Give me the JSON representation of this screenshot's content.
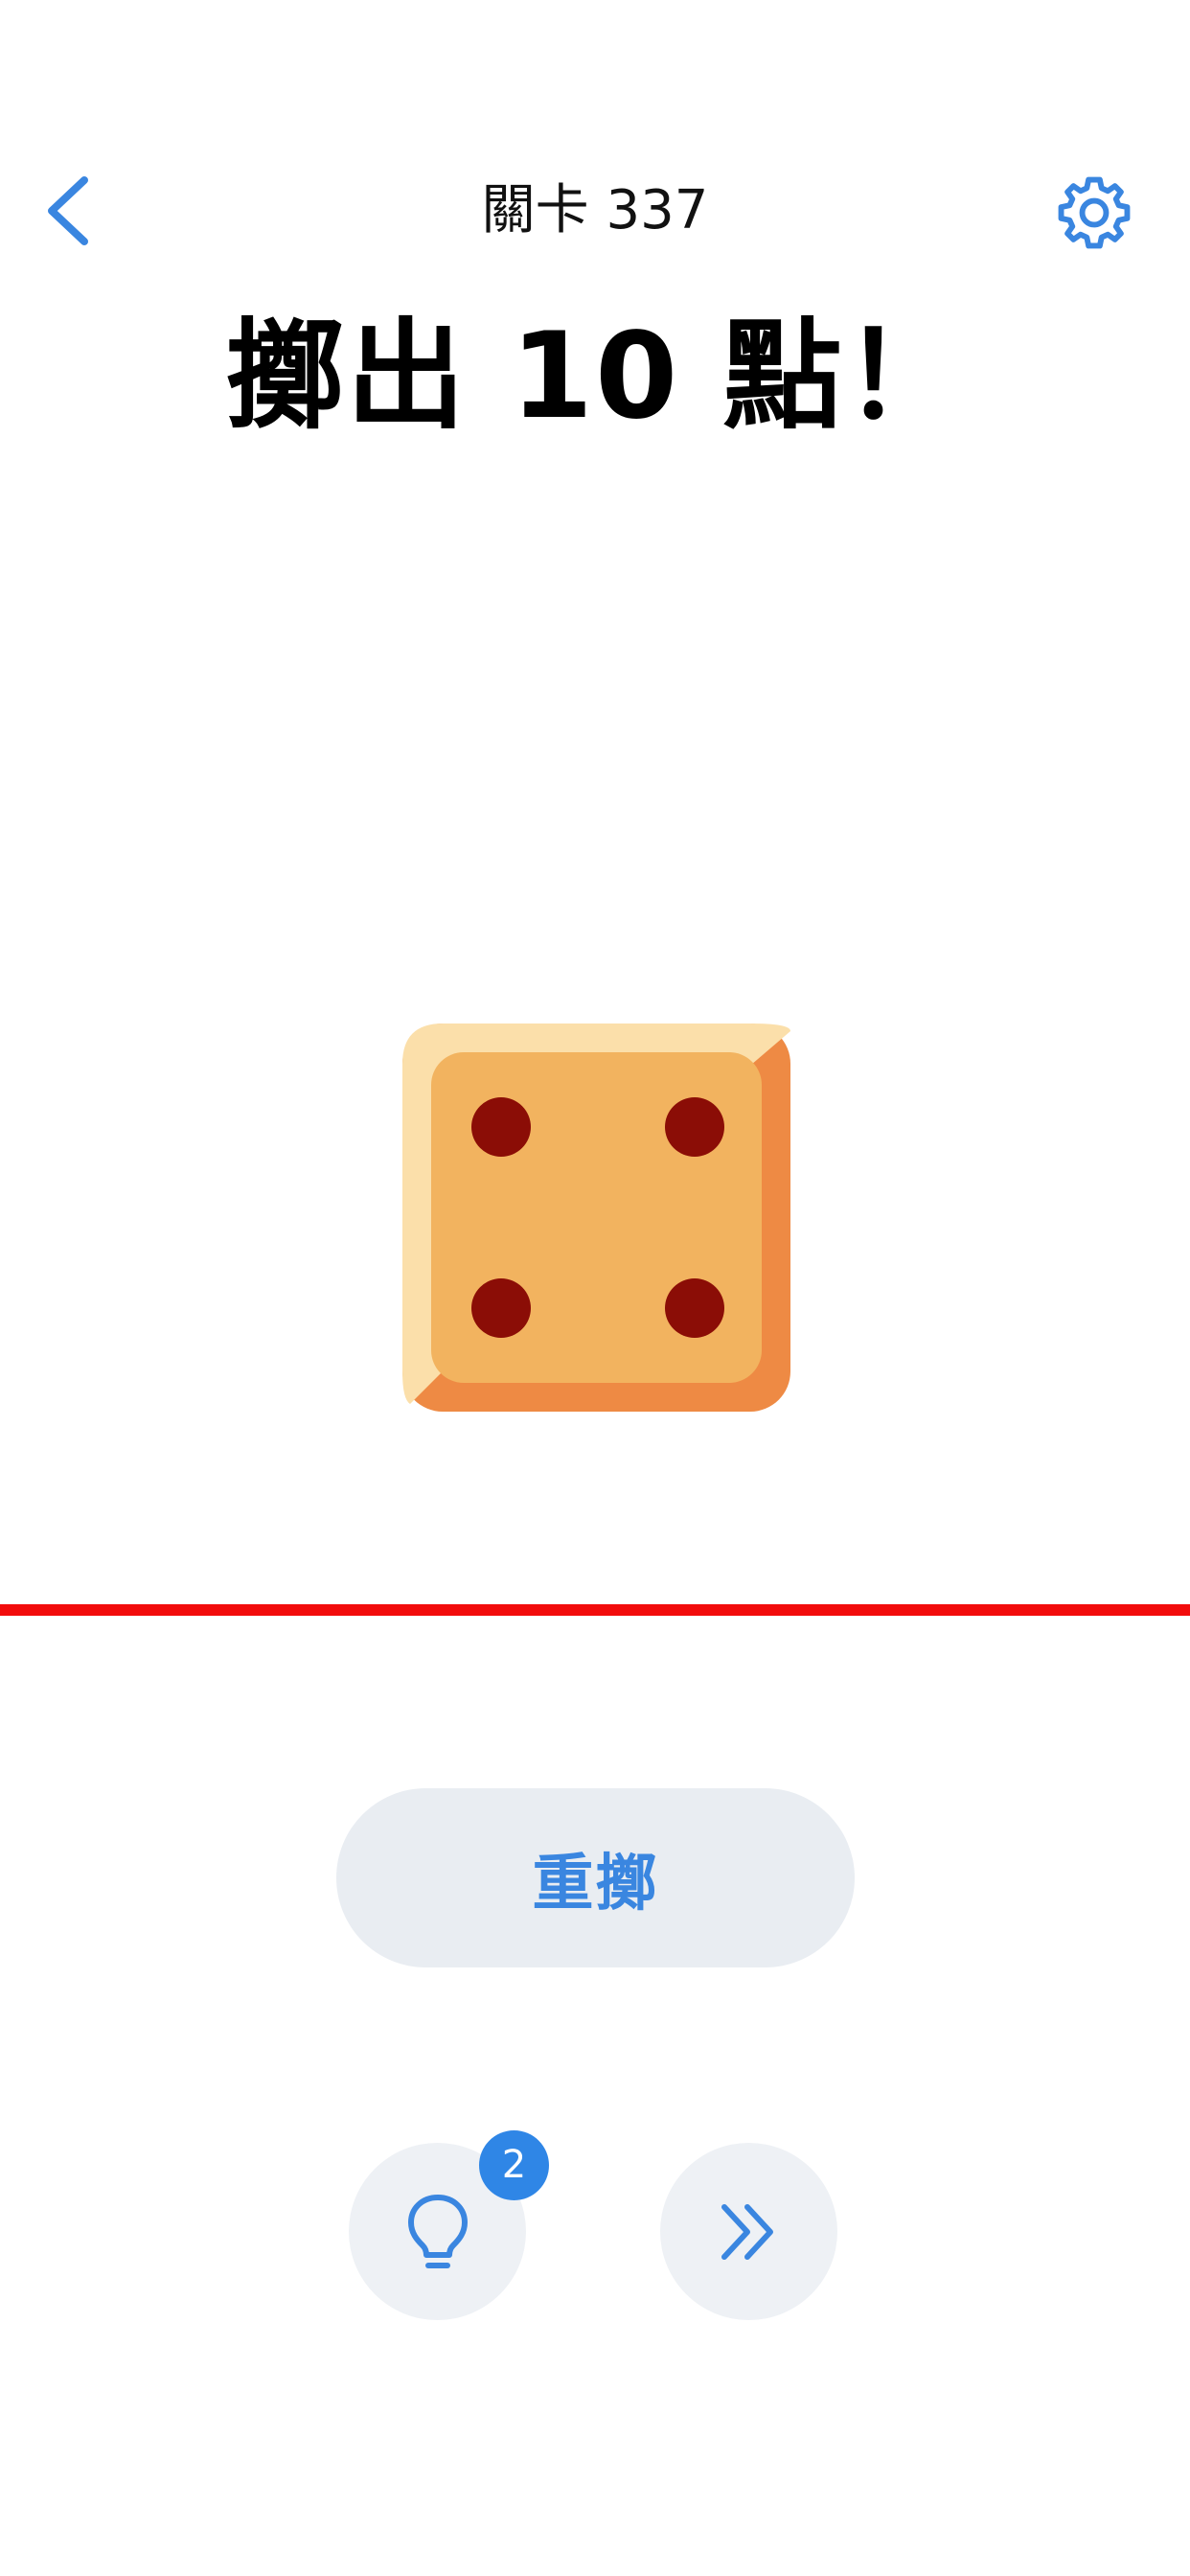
{
  "header": {
    "level_title": "關卡 337"
  },
  "objective": {
    "text": "擲出 10 點！"
  },
  "die": {
    "face_value": 4,
    "colors": {
      "face": "#f2b35f",
      "highlight": "#fbdfaa",
      "shadow": "#ee8a44",
      "pip": "#8b0d06"
    }
  },
  "actions": {
    "reroll_label": "重擲",
    "hint_count": "2",
    "hint_icon": "lightbulb-icon",
    "skip_icon": "double-chevron-right-icon"
  },
  "colors": {
    "accent": "#3a86e0",
    "target_line": "#f20c0c",
    "badge": "#2f86e6"
  }
}
